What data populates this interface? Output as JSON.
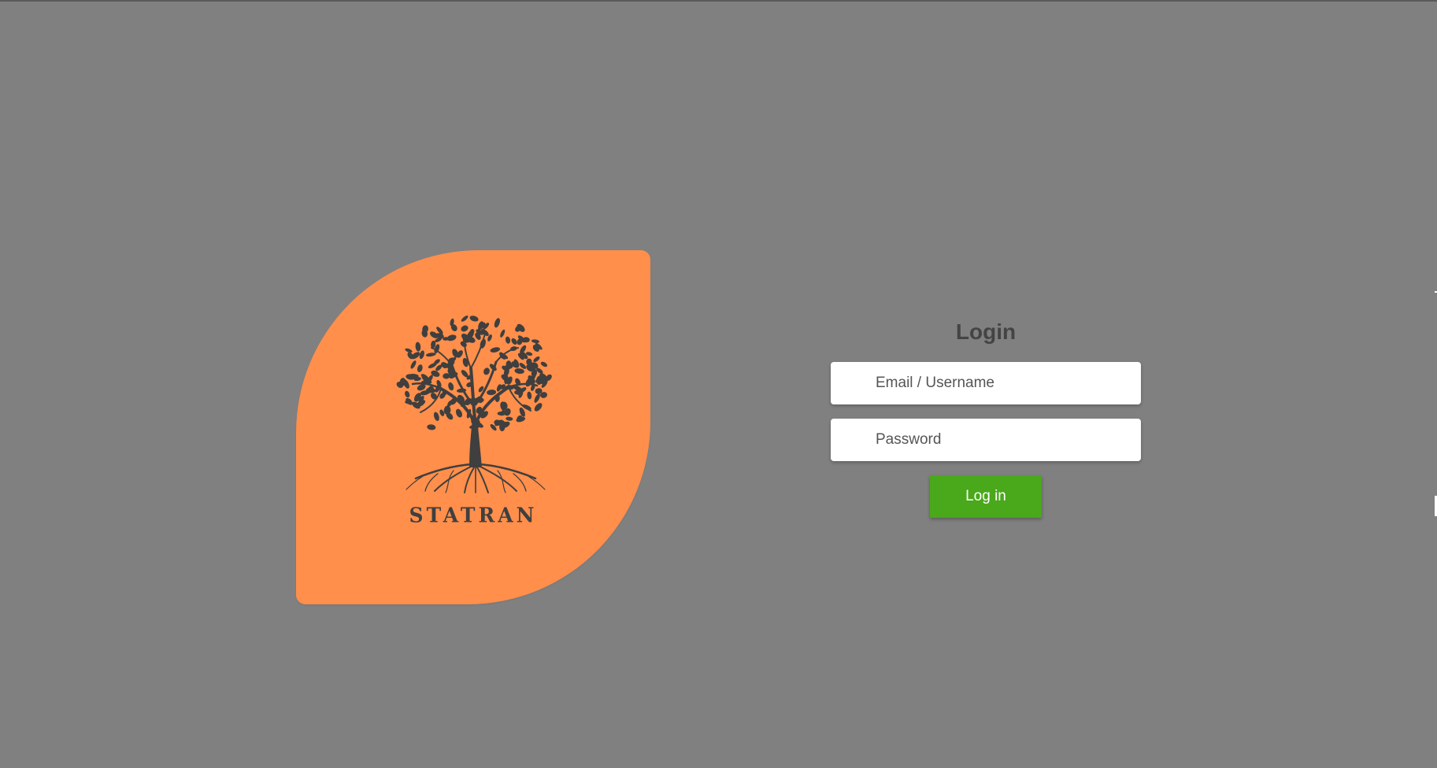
{
  "brand": {
    "name": "STATRAN",
    "logo_icon": "tree-with-roots-icon",
    "card_color": "#ff8f4b",
    "ink_color": "#3f3f3f"
  },
  "login": {
    "title": "Login",
    "email_placeholder": "Email / Username",
    "password_placeholder": "Password",
    "submit_label": "Log in",
    "submit_color": "#4aa81b"
  },
  "page": {
    "background": "#808080"
  }
}
